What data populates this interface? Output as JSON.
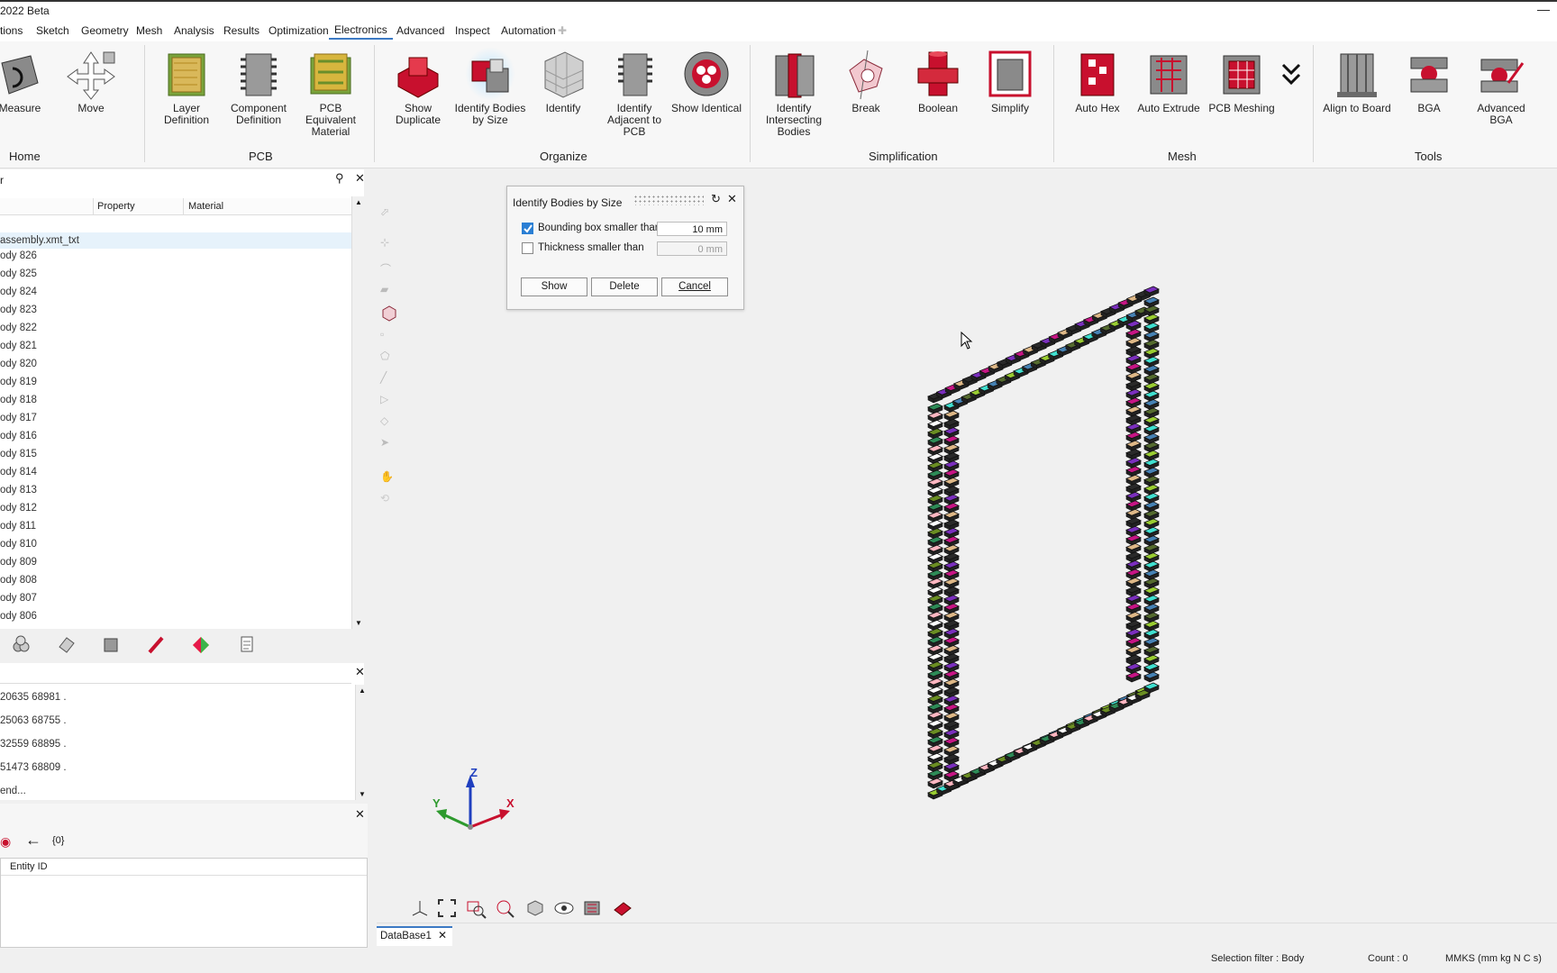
{
  "window": {
    "title": "2022 Beta",
    "minimize_icon": "minimize-icon"
  },
  "menu": {
    "items": [
      "tions",
      "Sketch",
      "Geometry",
      "Mesh",
      "Analysis",
      "Results",
      "Optimization",
      "Electronics",
      "Advanced",
      "Inspect",
      "Automation"
    ],
    "active": "Electronics"
  },
  "ribbon": {
    "buttons": [
      {
        "label": "Measure",
        "icon": "measure-icon"
      },
      {
        "label": "Move",
        "icon": "move-icon"
      },
      {
        "label": "Layer Definition",
        "icon": "layer-definition-icon"
      },
      {
        "label": "Component Definition",
        "icon": "component-definition-icon"
      },
      {
        "label": "PCB Equivalent Material",
        "icon": "pcb-material-icon"
      },
      {
        "label": "Show Duplicate",
        "icon": "show-duplicate-icon"
      },
      {
        "label": "Identify Bodies by Size",
        "icon": "identify-bodies-size-icon"
      },
      {
        "label": "Identify",
        "icon": "identify-icon"
      },
      {
        "label": "Identify Adjacent to PCB",
        "icon": "identify-adjacent-icon"
      },
      {
        "label": "Show Identical",
        "icon": "show-identical-icon"
      },
      {
        "label": "Identify Intersecting Bodies",
        "icon": "intersecting-bodies-icon"
      },
      {
        "label": "Break",
        "icon": "break-icon"
      },
      {
        "label": "Boolean",
        "icon": "boolean-icon"
      },
      {
        "label": "Simplify",
        "icon": "simplify-icon"
      },
      {
        "label": "Auto Hex",
        "icon": "auto-hex-icon"
      },
      {
        "label": "Auto Extrude",
        "icon": "auto-extrude-icon"
      },
      {
        "label": "PCB Meshing",
        "icon": "pcb-meshing-icon"
      },
      {
        "label": "Align to Board",
        "icon": "align-board-icon"
      },
      {
        "label": "BGA",
        "icon": "bga-icon"
      },
      {
        "label": "Advanced BGA",
        "icon": "advanced-bga-icon"
      }
    ],
    "groups": [
      "Home",
      "PCB",
      "Organize",
      "Simplification",
      "Mesh",
      "Tools"
    ],
    "more_icon": "chevron-double-down-icon"
  },
  "browser": {
    "title": "r",
    "columns": [
      "Property",
      "Material"
    ],
    "root": "assembly.xmt_txt",
    "rows": [
      "ody 826",
      "ody 825",
      "ody 824",
      "ody 823",
      "ody 822",
      "ody 821",
      "ody 820",
      "ody 819",
      "ody 818",
      "ody 817",
      "ody 816",
      "ody 815",
      "ody 814",
      "ody 813",
      "ody 812",
      "ody 811",
      "ody 810",
      "ody 809",
      "ody 808",
      "ody 807",
      "ody 806"
    ]
  },
  "console": {
    "lines": [
      "20635 68981 .",
      "25063 68755 .",
      "32559 68895 .",
      "51473 68809 .",
      "end..."
    ]
  },
  "entity": {
    "selection": "{0}",
    "column": "Entity ID"
  },
  "dialog": {
    "title": "Identify Bodies by Size",
    "bbox_label": "Bounding box smaller than",
    "bbox_value": "10 mm",
    "bbox_checked": true,
    "thick_label": "Thickness smaller than",
    "thick_value": "0 mm",
    "thick_checked": false,
    "show": "Show",
    "delete": "Delete",
    "cancel": "Cancel"
  },
  "triad": {
    "x": "X",
    "y": "Y",
    "z": "Z"
  },
  "tab": {
    "name": "DataBase1"
  },
  "statusbar": {
    "filter": "Selection filter : Body",
    "count": "Count : 0",
    "units": "MMKS (mm kg N C s)"
  },
  "colors": {
    "accent": "#3c7ac4",
    "body_palette": [
      "#2a2a2a",
      "#6b8e23",
      "#9acd32",
      "#7b2fbe",
      "#2e8b57",
      "#40e0d0",
      "#c71585",
      "#ffb6c1",
      "#4682b4",
      "#deb887",
      "#ffffff",
      "#556b2f"
    ]
  }
}
